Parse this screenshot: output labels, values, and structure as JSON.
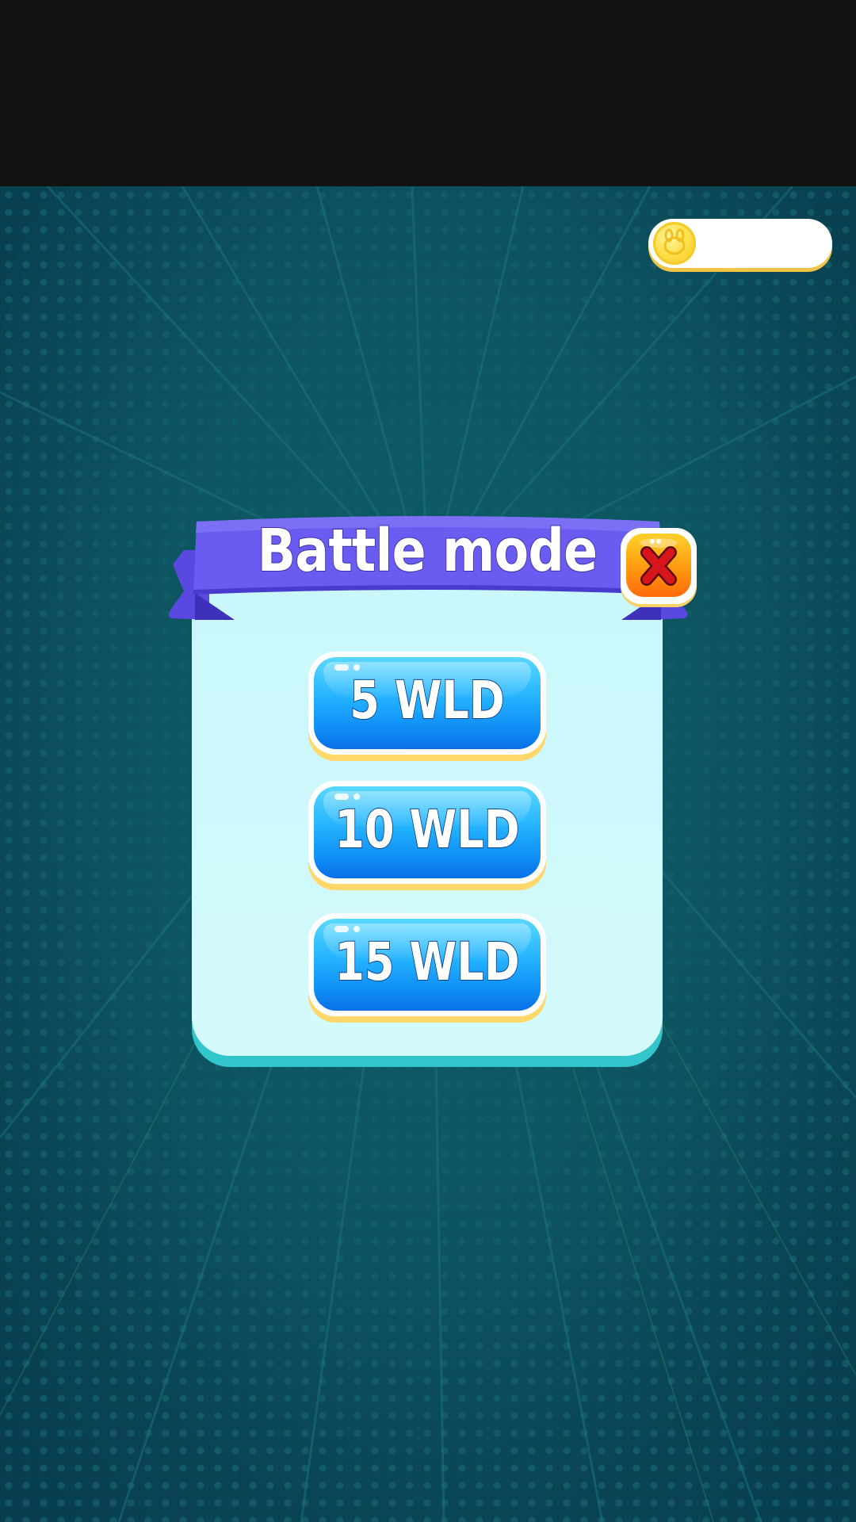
{
  "status_bar": {},
  "coin_balance": {
    "icon": "coin-icon",
    "amount": ""
  },
  "dialog": {
    "title": "Battle mode",
    "close_icon": "close-icon",
    "options": [
      {
        "label": "5 WLD"
      },
      {
        "label": "10 WLD"
      },
      {
        "label": "15 WLD"
      }
    ]
  },
  "colors": {
    "background": "#0c4c5a",
    "ribbon": "#6a5cf0",
    "card": "#c9f7fb",
    "button": "#1aa6ff",
    "close_button": "#ff8a10"
  }
}
